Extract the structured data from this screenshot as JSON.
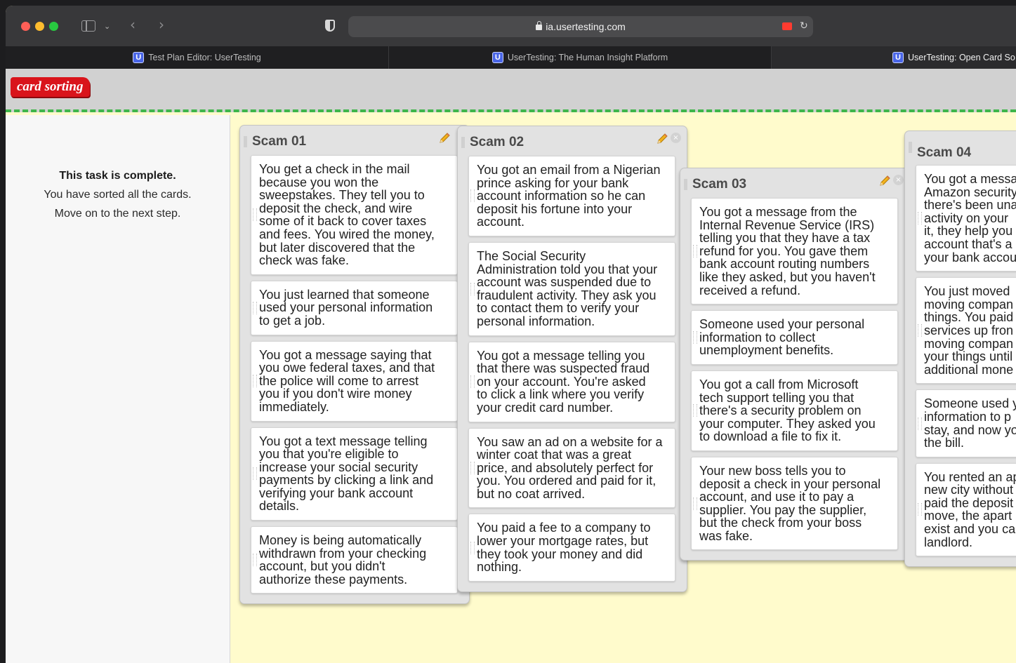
{
  "browser": {
    "url": "ia.usertesting.com",
    "tabs": [
      {
        "label": "Test Plan Editor: UserTesting",
        "favicon": "U"
      },
      {
        "label": "UserTesting: The Human Insight Platform",
        "favicon": "U"
      },
      {
        "label": "UserTesting: Open Card So",
        "favicon": "U"
      }
    ]
  },
  "app": {
    "logo": "card sorting",
    "colors": {
      "accent": "#d9141b",
      "divider": "#3eb54a",
      "workspace": "#fffbcc"
    }
  },
  "status": {
    "title": "This task is complete.",
    "line1": "You have sorted all the cards.",
    "line2": "Move on to the next step."
  },
  "boards": [
    {
      "title": "Scam 01",
      "cards": [
        [
          "You get a check in the mail",
          "because you won the",
          "sweepstakes. They tell you to",
          "deposit the check, and wire",
          "some of it back to cover taxes",
          "and fees. You wired the money,",
          "but later discovered that the",
          "check was fake."
        ],
        [
          "You just learned that someone",
          "used your personal information",
          "to get a job."
        ],
        [
          "You got a message saying that",
          "you owe federal taxes, and that",
          "the police will come to arrest",
          "you if you don't wire money",
          "immediately."
        ],
        [
          "You got a text message telling",
          "you that you're eligible to",
          "increase your social security",
          "payments by clicking a link and",
          "verifying your bank account",
          "details."
        ],
        [
          "Money is being automatically",
          "withdrawn from your checking",
          "account, but you didn't",
          "authorize these payments."
        ]
      ]
    },
    {
      "title": "Scam 02",
      "cards": [
        [
          "You got an email from a Nigerian",
          "prince asking for your bank",
          "account information so he can",
          "deposit his fortune into your",
          "account."
        ],
        [
          "The Social Security",
          "Administration told you that your",
          "account was suspended due to",
          "fraudulent activity. They ask you",
          "to contact them to verify your",
          "personal information."
        ],
        [
          "You got a message telling you",
          "that there was suspected fraud",
          "on your account. You're asked",
          "to click a link where you verify",
          "your credit card number."
        ],
        [
          "You saw an ad on a website for a",
          "winter coat that was a great",
          "price, and absolutely perfect for",
          "you. You ordered and paid for it,",
          "but no coat arrived."
        ],
        [
          "You paid a fee to a company to",
          "lower your mortgage rates, but",
          "they took your money and did",
          "nothing."
        ]
      ]
    },
    {
      "title": "Scam 03",
      "cards": [
        [
          "You got a message from the",
          "Internal Revenue Service (IRS)",
          "telling you that they have a tax",
          "refund for you. You gave them",
          "bank account routing numbers",
          "like they asked, but you haven't",
          "received a refund."
        ],
        [
          "Someone used your personal",
          "information to collect",
          "unemployment benefits."
        ],
        [
          "You got a call from Microsoft",
          "tech support telling you that",
          "there's a security problem on",
          "your computer. They asked you",
          "to download a file to fix it."
        ],
        [
          "Your new boss tells you to",
          "deposit a check in your personal",
          "account, and use it to pay a",
          "supplier. You pay the supplier,",
          "but the check from your boss",
          "was fake."
        ]
      ]
    },
    {
      "title": "Scam 04",
      "cards": [
        [
          "You got a messa",
          "Amazon security",
          "there's been una",
          "activity on your",
          "it, they help you",
          "account that's a",
          "your bank accou"
        ],
        [
          "You just moved",
          "moving compan",
          "things. You paid",
          "services up fron",
          "moving compan",
          "your things until",
          "additional mone"
        ],
        [
          "Someone used y",
          "information to p",
          "stay, and now yo",
          "the bill."
        ],
        [
          "You rented an ap",
          "new city without",
          "paid the deposit",
          "move, the apart",
          "exist and you ca",
          "landlord."
        ]
      ]
    }
  ]
}
